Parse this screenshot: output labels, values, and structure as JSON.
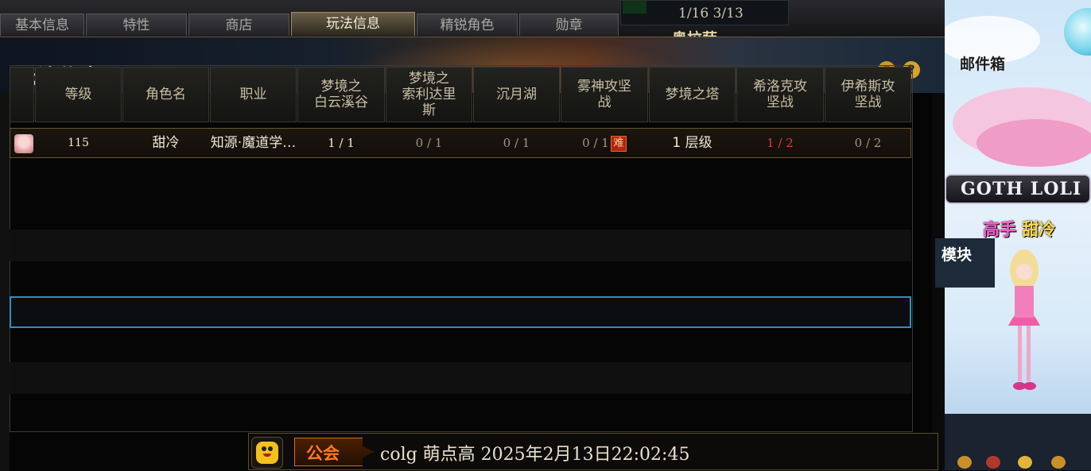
{
  "tabs": [
    "基本信息",
    "特性",
    "商店",
    "玩法信息",
    "精锐角色",
    "勋章"
  ],
  "active_tab": "玩法信息",
  "top_stat": "1/16 3/13",
  "top_name": "奥拉萨",
  "panel": {
    "title": "玩法信息",
    "settings_icon": "gear-icon",
    "help_icon": "help-icon",
    "help_glyph": "?"
  },
  "table": {
    "headers": [
      "等级",
      "角色名",
      "职业",
      "梦境之\n白云溪谷",
      "梦境之\n索利达里\n斯",
      "沉月湖",
      "雾神攻坚\n战",
      "梦境之塔",
      "希洛克攻\n坚战",
      "伊希斯攻\n坚战"
    ],
    "row": {
      "level": "115",
      "name": "甜冷",
      "job": "知源·魔道学…",
      "c1": "1 / 1",
      "c2": "0 / 1",
      "c3": "0 / 1",
      "c4": "0 / 1",
      "c4_badge": "难",
      "c5": "1 层级",
      "c6": "1 / 2",
      "c7": "0 / 2"
    }
  },
  "chat": {
    "channel": "公会",
    "message": "colg  萌点高  2025年2月13日22:02:45"
  },
  "side": {
    "mailbox": "邮件箱",
    "title_plate": "GOTH LOLI",
    "rank_label": "高手",
    "rank_name": "甜冷",
    "module_text": "模块"
  },
  "colors": {
    "accent_gold": "#a08b63",
    "selection_blue": "#2e8fc4",
    "red_value": "#e23b3b",
    "guild_orange": "#ff7a1a"
  }
}
